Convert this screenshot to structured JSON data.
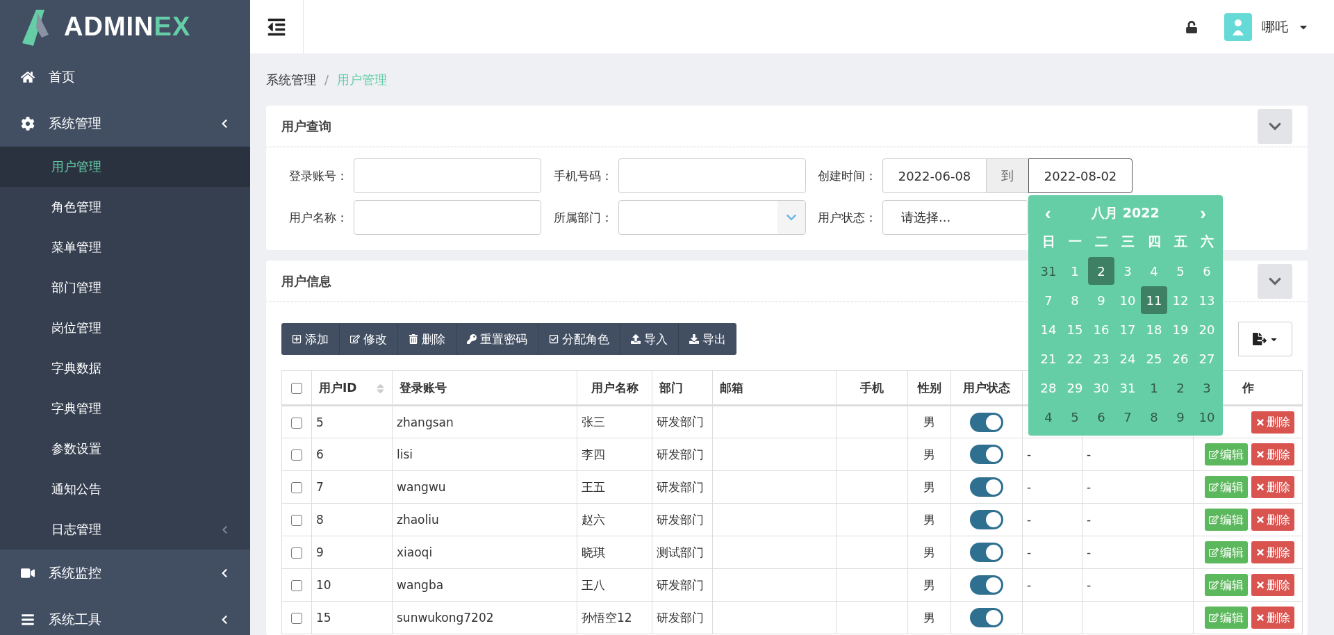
{
  "logo": {
    "name": "ADMIN",
    "accent": "EX"
  },
  "sidebar": {
    "items": [
      {
        "label": "首页",
        "expandable": false
      },
      {
        "label": "系统管理",
        "expandable": true,
        "children": [
          {
            "label": "用户管理",
            "selected": true,
            "expandable": false
          },
          {
            "label": "角色管理",
            "selected": false,
            "expandable": false
          },
          {
            "label": "菜单管理",
            "selected": false,
            "expandable": false
          },
          {
            "label": "部门管理",
            "selected": false,
            "expandable": false
          },
          {
            "label": "岗位管理",
            "selected": false,
            "expandable": false
          },
          {
            "label": "字典数据",
            "selected": false,
            "expandable": false
          },
          {
            "label": "字典管理",
            "selected": false,
            "expandable": false
          },
          {
            "label": "参数设置",
            "selected": false,
            "expandable": false
          },
          {
            "label": "通知公告",
            "selected": false,
            "expandable": false
          },
          {
            "label": "日志管理",
            "selected": false,
            "expandable": true
          }
        ]
      },
      {
        "label": "系统监控",
        "expandable": true
      },
      {
        "label": "系统工具",
        "expandable": true
      }
    ]
  },
  "header": {
    "user": "哪吒"
  },
  "breadcrumb": {
    "separator": "/",
    "items": [
      {
        "label": "系统管理",
        "selected": false
      },
      {
        "label": "用户管理",
        "selected": true
      }
    ]
  },
  "query": {
    "title": "用户查询",
    "fields": [
      {
        "label": "登录账号：",
        "kind": "text"
      },
      {
        "label": "手机号码：",
        "kind": "text"
      },
      {
        "label": "创建时间：",
        "kind": "daterange",
        "start": "2022-06-08",
        "separator": "到",
        "end": "2022-08-02"
      },
      {
        "label": "用户名称：",
        "kind": "text"
      },
      {
        "label": "所属部门：",
        "kind": "tree"
      },
      {
        "label": "用户状态：",
        "kind": "select",
        "value": "请选择..."
      }
    ]
  },
  "calendar": {
    "title": "八月 2022",
    "prev": "‹",
    "next": "›",
    "weekdays": [
      "日",
      "一",
      "二",
      "三",
      "四",
      "五",
      "六"
    ],
    "weeks": [
      [
        {
          "d": "31",
          "muted": true,
          "selected": false
        },
        {
          "d": "1",
          "muted": false,
          "selected": false
        },
        {
          "d": "2",
          "muted": false,
          "selected": true
        },
        {
          "d": "3",
          "muted": false,
          "selected": false
        },
        {
          "d": "4",
          "muted": false,
          "selected": false
        },
        {
          "d": "5",
          "muted": false,
          "selected": false
        },
        {
          "d": "6",
          "muted": false,
          "selected": false
        }
      ],
      [
        {
          "d": "7",
          "muted": false,
          "selected": false
        },
        {
          "d": "8",
          "muted": false,
          "selected": false
        },
        {
          "d": "9",
          "muted": false,
          "selected": false
        },
        {
          "d": "10",
          "muted": false,
          "selected": false
        },
        {
          "d": "11",
          "muted": false,
          "selected": true
        },
        {
          "d": "12",
          "muted": false,
          "selected": false
        },
        {
          "d": "13",
          "muted": false,
          "selected": false
        }
      ],
      [
        {
          "d": "14",
          "muted": false,
          "selected": false
        },
        {
          "d": "15",
          "muted": false,
          "selected": false
        },
        {
          "d": "16",
          "muted": false,
          "selected": false
        },
        {
          "d": "17",
          "muted": false,
          "selected": false
        },
        {
          "d": "18",
          "muted": false,
          "selected": false
        },
        {
          "d": "19",
          "muted": false,
          "selected": false
        },
        {
          "d": "20",
          "muted": false,
          "selected": false
        }
      ],
      [
        {
          "d": "21",
          "muted": false,
          "selected": false
        },
        {
          "d": "22",
          "muted": false,
          "selected": false
        },
        {
          "d": "23",
          "muted": false,
          "selected": false
        },
        {
          "d": "24",
          "muted": false,
          "selected": false
        },
        {
          "d": "25",
          "muted": false,
          "selected": false
        },
        {
          "d": "26",
          "muted": false,
          "selected": false
        },
        {
          "d": "27",
          "muted": false,
          "selected": false
        }
      ],
      [
        {
          "d": "28",
          "muted": false,
          "selected": false
        },
        {
          "d": "29",
          "muted": false,
          "selected": false
        },
        {
          "d": "30",
          "muted": false,
          "selected": false
        },
        {
          "d": "31",
          "muted": false,
          "selected": false
        },
        {
          "d": "1",
          "muted": true,
          "selected": false
        },
        {
          "d": "2",
          "muted": true,
          "selected": false
        },
        {
          "d": "3",
          "muted": true,
          "selected": false
        }
      ],
      [
        {
          "d": "4",
          "muted": true,
          "selected": false
        },
        {
          "d": "5",
          "muted": true,
          "selected": false
        },
        {
          "d": "6",
          "muted": true,
          "selected": false
        },
        {
          "d": "7",
          "muted": true,
          "selected": false
        },
        {
          "d": "8",
          "muted": true,
          "selected": false
        },
        {
          "d": "9",
          "muted": true,
          "selected": false
        },
        {
          "d": "10",
          "muted": true,
          "selected": false
        }
      ]
    ]
  },
  "users": {
    "title": "用户信息",
    "toolbar": [
      {
        "kind": "add",
        "label": "添加"
      },
      {
        "kind": "edit",
        "label": "修改"
      },
      {
        "kind": "delete",
        "label": "删除"
      },
      {
        "kind": "key",
        "label": "重置密码"
      },
      {
        "kind": "check",
        "label": "分配角色"
      },
      {
        "kind": "import",
        "label": "导入"
      },
      {
        "kind": "export",
        "label": "导出"
      }
    ],
    "select_all": {
      "checked": false
    },
    "columns": [
      {
        "label": "用户ID",
        "sortable": true
      },
      {
        "label": "登录账号",
        "sortable": false
      },
      {
        "label": "用户名称",
        "sortable": false
      },
      {
        "label": "部门",
        "sortable": false
      },
      {
        "label": "邮箱",
        "sortable": false
      },
      {
        "label": "手机",
        "sortable": false
      },
      {
        "label": "性别",
        "sortable": false
      },
      {
        "label": "用户状态",
        "sortable": false
      },
      {},
      {},
      {
        "label": "作",
        "sortable": false
      }
    ],
    "rows": [
      {
        "checked": false,
        "id": "5",
        "account": "zhangsan",
        "name": "张三",
        "dept": "研发部门",
        "gender": "男",
        "enabled": true,
        "actions": [
          {
            "kind": "delete",
            "label": "删除"
          }
        ]
      },
      {
        "checked": false,
        "id": "6",
        "account": "lisi",
        "name": "李四",
        "dept": "研发部门",
        "gender": "男",
        "enabled": true,
        "column_9": "-",
        "column_10": "-",
        "actions": [
          {
            "kind": "edit",
            "label": "编辑"
          },
          {
            "kind": "delete",
            "label": "删除"
          }
        ]
      },
      {
        "checked": false,
        "id": "7",
        "account": "wangwu",
        "name": "王五",
        "dept": "研发部门",
        "gender": "男",
        "enabled": true,
        "column_9": "-",
        "column_10": "-",
        "actions": [
          {
            "kind": "edit",
            "label": "编辑"
          },
          {
            "kind": "delete",
            "label": "删除"
          }
        ]
      },
      {
        "checked": false,
        "id": "8",
        "account": "zhaoliu",
        "name": "赵六",
        "dept": "研发部门",
        "gender": "男",
        "enabled": true,
        "column_9": "-",
        "column_10": "-",
        "actions": [
          {
            "kind": "edit",
            "label": "编辑"
          },
          {
            "kind": "delete",
            "label": "删除"
          }
        ]
      },
      {
        "checked": false,
        "id": "9",
        "account": "xiaoqi",
        "name": "晓琪",
        "dept": "测试部门",
        "gender": "男",
        "enabled": true,
        "column_9": "-",
        "column_10": "-",
        "actions": [
          {
            "kind": "edit",
            "label": "编辑"
          },
          {
            "kind": "delete",
            "label": "删除"
          }
        ]
      },
      {
        "checked": false,
        "id": "10",
        "account": "wangba",
        "name": "王八",
        "dept": "研发部门",
        "gender": "男",
        "enabled": true,
        "column_9": "-",
        "column_10": "-",
        "actions": [
          {
            "kind": "edit",
            "label": "编辑"
          },
          {
            "kind": "delete",
            "label": "删除"
          }
        ]
      },
      {
        "checked": false,
        "id": "15",
        "account": "sunwukong7202",
        "name": "孙悟空12",
        "dept": "研发部门",
        "gender": "男",
        "enabled": true,
        "actions": [
          {
            "kind": "edit",
            "label": "编辑"
          },
          {
            "kind": "delete",
            "label": "删除"
          }
        ]
      }
    ]
  }
}
